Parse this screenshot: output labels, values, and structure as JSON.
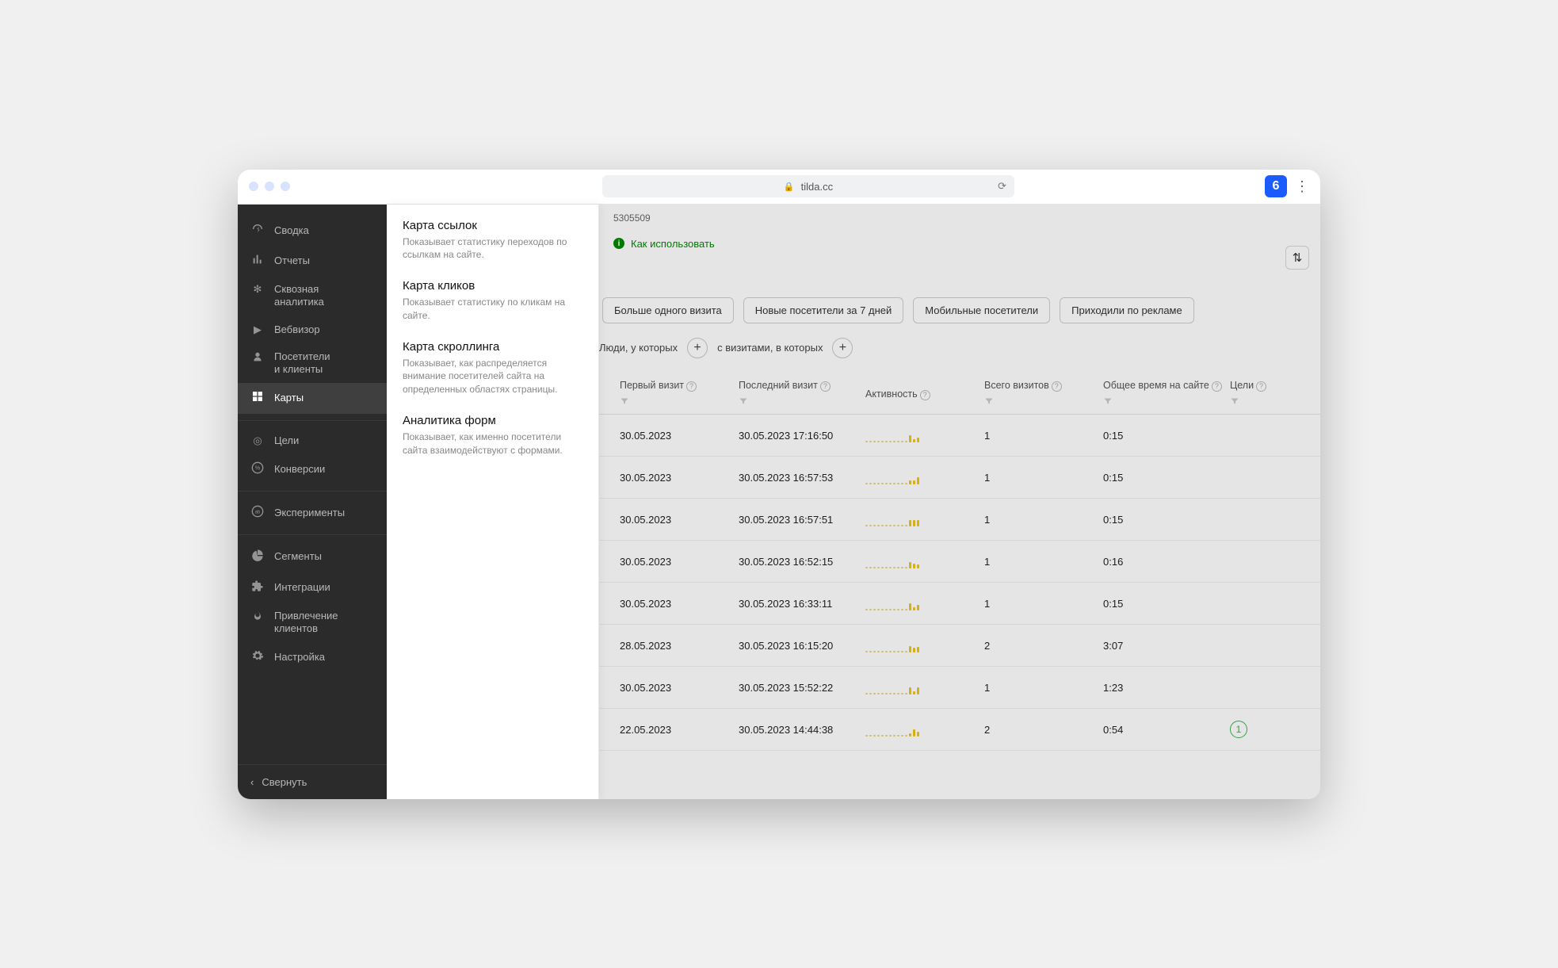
{
  "browser": {
    "url": "tilda.cc",
    "ext_label": "6"
  },
  "sidebar": {
    "items": [
      {
        "label": "Сводка",
        "icon": "dashboard"
      },
      {
        "label": "Отчеты",
        "icon": "bars"
      },
      {
        "label": "Сквозная\nаналитика",
        "icon": "spark"
      },
      {
        "label": "Вебвизор",
        "icon": "play"
      },
      {
        "label": "Посетители\nи клиенты",
        "icon": "person"
      },
      {
        "label": "Карты",
        "icon": "grid"
      },
      {
        "label": "Цели",
        "icon": "target"
      },
      {
        "label": "Конверсии",
        "icon": "percent"
      },
      {
        "label": "Эксперименты",
        "icon": "ab"
      },
      {
        "label": "Сегменты",
        "icon": "pie"
      },
      {
        "label": "Интеграции",
        "icon": "puzzle"
      },
      {
        "label": "Привлечение\nклиентов",
        "icon": "flame"
      },
      {
        "label": "Настройка",
        "icon": "gear"
      }
    ],
    "collapse": "Свернуть"
  },
  "flyout": [
    {
      "title": "Карта ссылок",
      "desc": "Показывает статистику переходов по ссылкам на сайте."
    },
    {
      "title": "Карта кликов",
      "desc": "Показывает статистику по кликам на сайте."
    },
    {
      "title": "Карта скроллинга",
      "desc": "Показывает, как распределяется внимание посетителей сайта на определенных областях страницы."
    },
    {
      "title": "Аналитика форм",
      "desc": "Показывает, как именно посетители сайта взаимодействуют с формами."
    }
  ],
  "main": {
    "counter_fragment": "5305509",
    "hint": "Как использовать",
    "filters": [
      "Больше одного визита",
      "Новые посетители за 7 дней",
      "Мобильные посетители",
      "Приходили по рекламе"
    ],
    "seg_a": "Люди, у которых",
    "seg_b": "с визитами, в которых",
    "columns": {
      "first_visit": "Первый визит",
      "last_visit": "Последний визит",
      "activity": "Активность",
      "visits": "Всего визитов",
      "total_time": "Общее время на сайте",
      "goals": "Цели"
    },
    "rows": [
      {
        "first": "30.05.2023",
        "last": "30.05.2023 17:16:50",
        "visits": "1",
        "time": "0:15",
        "goal": ""
      },
      {
        "first": "30.05.2023",
        "last": "30.05.2023 16:57:53",
        "visits": "1",
        "time": "0:15",
        "goal": ""
      },
      {
        "first": "30.05.2023",
        "last": "30.05.2023 16:57:51",
        "visits": "1",
        "time": "0:15",
        "goal": ""
      },
      {
        "first": "30.05.2023",
        "last": "30.05.2023 16:52:15",
        "visits": "1",
        "time": "0:16",
        "goal": ""
      },
      {
        "first": "30.05.2023",
        "last": "30.05.2023 16:33:11",
        "visits": "1",
        "time": "0:15",
        "goal": ""
      },
      {
        "first": "28.05.2023",
        "last": "30.05.2023 16:15:20",
        "visits": "2",
        "time": "3:07",
        "goal": ""
      },
      {
        "first": "30.05.2023",
        "last": "30.05.2023 15:52:22",
        "visits": "1",
        "time": "1:23",
        "goal": ""
      },
      {
        "first": "22.05.2023",
        "last": "30.05.2023 14:44:38",
        "visits": "2",
        "time": "0:54",
        "goal": "1"
      }
    ]
  }
}
